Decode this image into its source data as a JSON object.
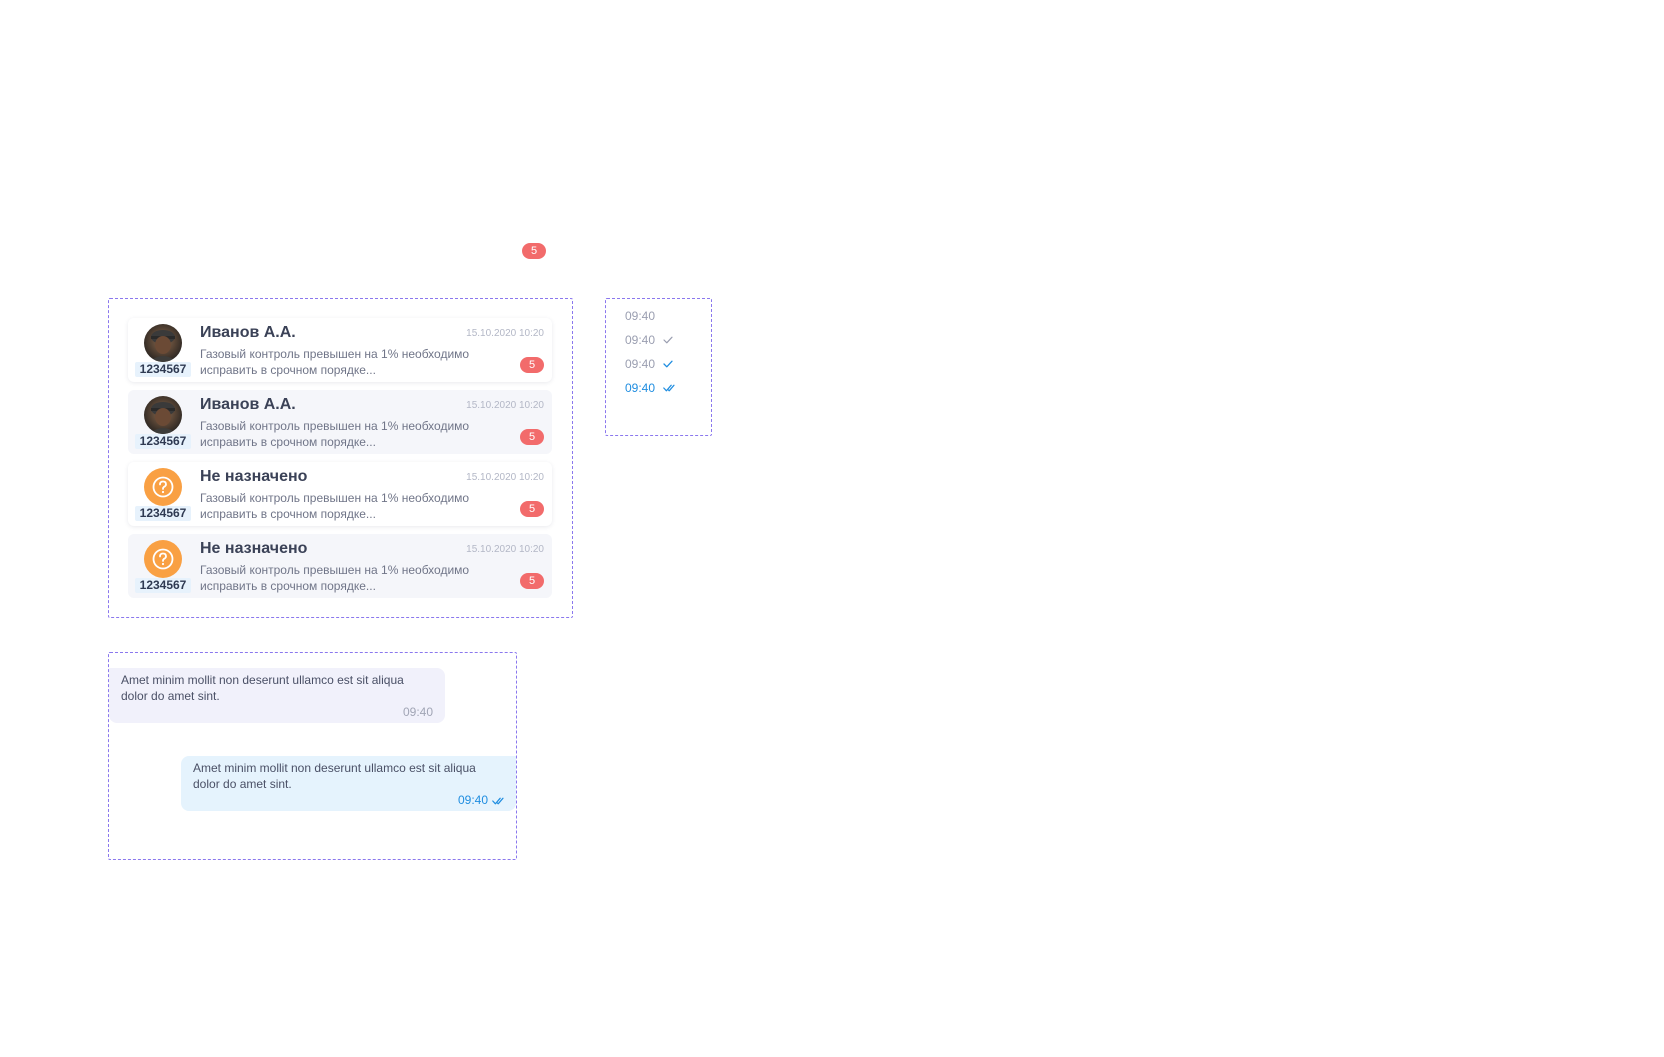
{
  "standalone_badge": {
    "count": "5"
  },
  "chat_list": [
    {
      "name": "Иванов А.А.",
      "date": "15.10.2020 10:20",
      "preview": "Газовый контроль превышен на 1% необходимо исправить в срочном порядке...",
      "id": "1234567",
      "unread": "5",
      "avatar": "photo"
    },
    {
      "name": "Иванов А.А.",
      "date": "15.10.2020 10:20",
      "preview": "Газовый контроль превышен на 1% необходимо исправить в срочном порядке...",
      "id": "1234567",
      "unread": "5",
      "avatar": "photo"
    },
    {
      "name": "Не назначено",
      "date": "15.10.2020 10:20",
      "preview": "Газовый контроль превышен на 1% необходимо исправить в срочном порядке...",
      "id": "1234567",
      "unread": "5",
      "avatar": "question-icon"
    },
    {
      "name": "Не назначено",
      "date": "15.10.2020 10:20",
      "preview": "Газовый контроль превышен на 1% необходимо исправить в срочном порядке...",
      "id": "1234567",
      "unread": "5",
      "avatar": "question-icon"
    }
  ],
  "message_statuses": [
    {
      "time": "09:40",
      "status": "none"
    },
    {
      "time": "09:40",
      "status": "sent",
      "icon": "check-icon"
    },
    {
      "time": "09:40",
      "status": "delivered",
      "icon": "check-icon"
    },
    {
      "time": "09:40",
      "status": "read",
      "icon": "double-check-icon"
    }
  ],
  "messages": {
    "incoming": {
      "text": "Amet minim mollit non deserunt ullamco est sit aliqua dolor do amet sint.",
      "time": "09:40"
    },
    "outgoing": {
      "text": "Amet minim mollit non deserunt ullamco est sit aliqua dolor do amet sint.",
      "time": "09:40",
      "icon": "double-check-icon"
    }
  },
  "colors": {
    "badge": "#f26b6b",
    "accent_blue": "#1f8de0",
    "unassigned_orange": "#f9a043",
    "dashed_border": "#8b78ee",
    "incoming_bubble": "#f1f1fb",
    "outgoing_bubble": "#e5f3fd"
  }
}
